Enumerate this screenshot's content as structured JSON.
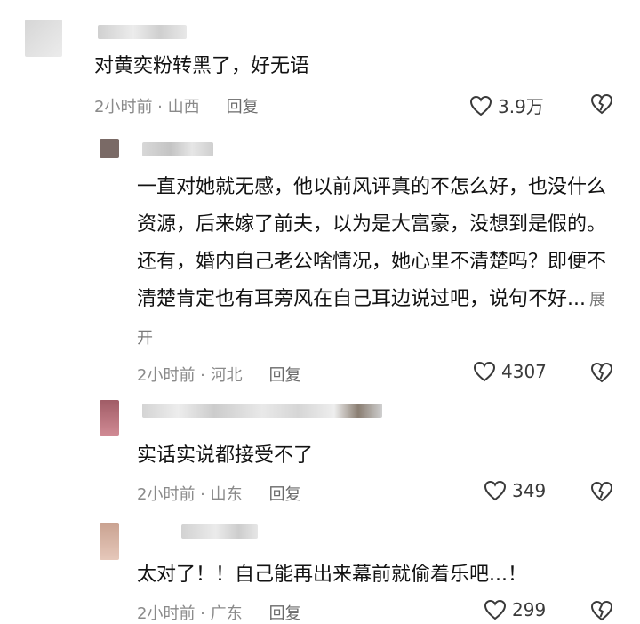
{
  "comments": [
    {
      "text": "对黄奕粉转黑了，好无语",
      "time": "2小时前 · ",
      "location": "山西",
      "reply": "回复",
      "likes": "3.9万"
    },
    {
      "text": "一直对她就无感，他以前风评真的不怎么好，也没什么资源，后来嫁了前夫，以为是大富豪，没想到是假的。还有，婚内自己老公啥情况，她心里不清楚吗？即便不清楚肯定也有耳旁风在自己耳边说过吧，说句不好...",
      "expand": "展开",
      "time": "2小时前 · ",
      "location": "河北",
      "reply": "回复",
      "likes": "4307"
    },
    {
      "text": "实话实说都接受不了",
      "time": "2小时前 · ",
      "location": "山东",
      "reply": "回复",
      "likes": "349"
    },
    {
      "text": "太对了！！自己能再出来幕前就偷着乐吧...！",
      "time": "2小时前 · ",
      "location": "广东",
      "reply": "回复",
      "likes": "299"
    }
  ],
  "icons": {
    "like": "heart-icon",
    "dislike": "broken-heart-icon"
  },
  "colors": {
    "text": "#121212",
    "meta": "#8a8a8a",
    "icon": "#3a3a3a"
  }
}
